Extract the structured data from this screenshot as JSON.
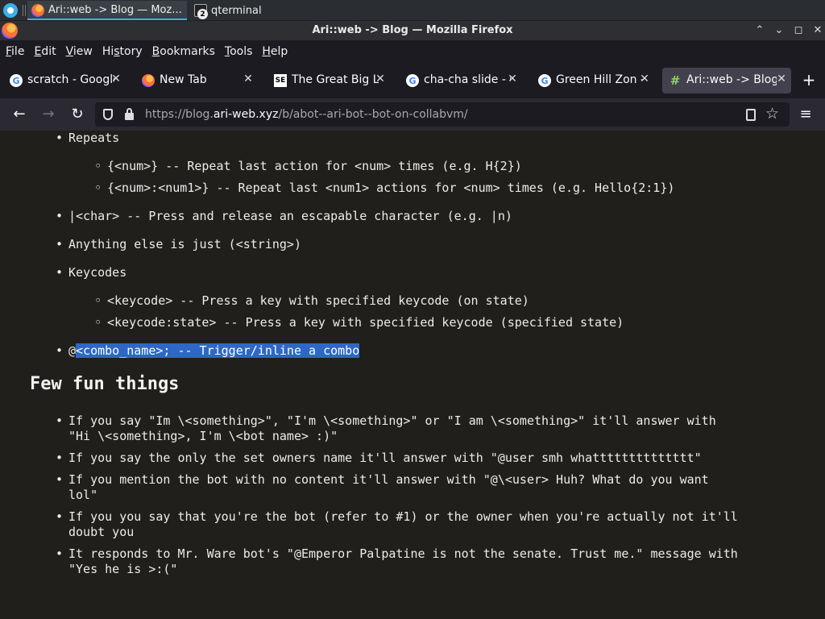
{
  "taskbar": {
    "tasks": [
      {
        "label": "Ari::web -> Blog — Moz...",
        "active": true
      },
      {
        "label": "qterminal",
        "active": false,
        "badge": "2"
      }
    ]
  },
  "window": {
    "title": "Ari::web -> Blog — Mozilla Firefox",
    "controls": {
      "minimize": "⌃",
      "restore": "⌄",
      "maximize": "◻",
      "close": "✕"
    }
  },
  "menubar": {
    "items": [
      {
        "pre": "",
        "key": "F",
        "post": "ile"
      },
      {
        "pre": "",
        "key": "E",
        "post": "dit"
      },
      {
        "pre": "",
        "key": "V",
        "post": "iew"
      },
      {
        "pre": "Hi",
        "key": "s",
        "post": "tory"
      },
      {
        "pre": "",
        "key": "B",
        "post": "ookmarks"
      },
      {
        "pre": "",
        "key": "T",
        "post": "ools"
      },
      {
        "pre": "",
        "key": "H",
        "post": "elp"
      }
    ]
  },
  "tabs": [
    {
      "label": "scratch - Google",
      "icon": "G"
    },
    {
      "label": "New Tab",
      "icon": ""
    },
    {
      "label": "The Great Big Li",
      "icon": "SE"
    },
    {
      "label": "cha-cha slide - G",
      "icon": "G"
    },
    {
      "label": "Green Hill Zon -",
      "icon": "G"
    },
    {
      "label": "Ari::web -> Blog",
      "icon": "#"
    }
  ],
  "new_tab_label": "+",
  "nav": {
    "back": "←",
    "forward": "→",
    "reload": "↻",
    "url_prefix": "https://blog.",
    "url_host": "ari-web.xyz",
    "url_path": "/b/abot--ari-bot--bot-on-collabvm/",
    "star": "☆",
    "menu": "≡"
  },
  "content": {
    "list1": [
      {
        "level": 1,
        "text": "Repeats"
      },
      {
        "level": 2,
        "text": "{<num>} -- Repeat last action for <num> times (e.g. H{2})"
      },
      {
        "level": 2,
        "text": "{<num>:<num1>} -- Repeat last <num1> actions for <num> times (e.g. Hello{2:1})"
      },
      {
        "level": 1,
        "text": "|<char> -- Press and release an escapable character (e.g. |n)"
      },
      {
        "level": 1,
        "text": "Anything else is just (<string>)"
      },
      {
        "level": 1,
        "text": "Keycodes"
      },
      {
        "level": 2,
        "text": "<keycode> -- Press a key with specified keycode (on state)"
      },
      {
        "level": 2,
        "text": "<keycode:state> -- Press a key with specified keycode (specified state)"
      }
    ],
    "combo_prefix": "@",
    "combo_selected": "<combo_name>; -- Trigger/inline a combo",
    "heading": "Few fun things",
    "fun_lines": [
      "If you say \"Im \\<something>\", \"I'm \\<something>\" or \"I am \\<something>\" it'll answer with",
      "\"Hi \\<something>, I'm \\<bot name> :)\"",
      "If you say the only the set owners name it'll answer with \"@user smh whatttttttttttttt\"",
      "If you mention the bot with no content it'll answer with \"@\\<user> Huh? What do you want",
      "lol\"",
      "If you you say that you're the bot (refer to #1) or the owner when you're actually not it'll",
      "doubt you",
      "It responds to Mr. Ware bot's \"@Emperor Palpatine is not the senate. Trust me.\" message with",
      "\"Yes he is >:(\""
    ]
  }
}
